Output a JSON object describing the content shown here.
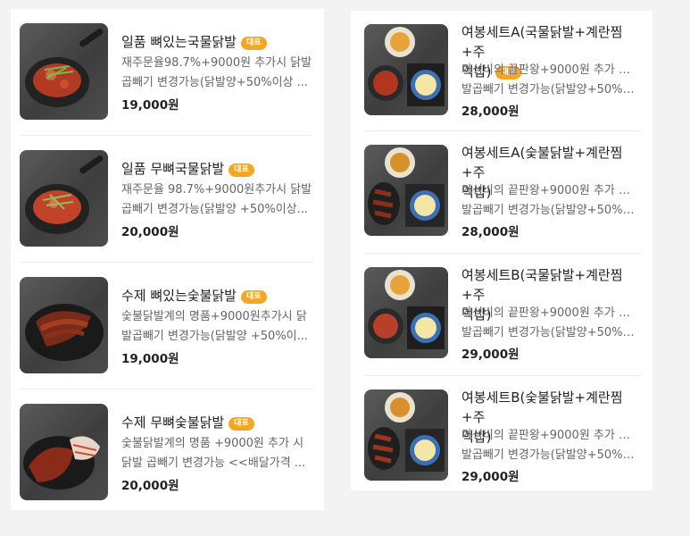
{
  "badge_label": "대표",
  "left_items": [
    {
      "title": "일품 뼈있는국물닭발",
      "desc_lines": [
        "재주문율98.7%+9000원 추가시 닭발",
        "곱빼기 변경가능(닭발양+50%이상 ..."
      ],
      "price": "19,000원"
    },
    {
      "title": "일품 무뼈국물닭발",
      "desc_lines": [
        "재주문율 98.7%+9000원추가시 닭발",
        "곱빼기 변경가능(닭발양 +50%이상..."
      ],
      "price": "20,000원"
    },
    {
      "title": "수제 뼈있는숯불닭발",
      "desc_lines": [
        "숯불닭발계의 명품+9000원추가시 닭",
        "발곱빼기 변경가능(닭발양 +50%이..."
      ],
      "price": "19,000원"
    },
    {
      "title": "수제 무뼈숯불닭발",
      "desc_lines": [
        "숯불닭발계의 명품 +9000원 추가 시",
        "닭발 곱빼기 변경가능 <<배달가격 ..."
      ],
      "price": "20,000원"
    }
  ],
  "right_items": [
    {
      "title_lines": [
        "여봉세트A(국물닭발+계란찜+주",
        "먹밥)"
      ],
      "desc_lines": [
        "가성비의 끝판왕+9000원 추가 시 닭",
        "발곱빼기 변경가능(닭발양+50%이..."
      ],
      "price": "28,000원",
      "has_badge": true
    },
    {
      "title_lines": [
        "여봉세트A(숯불닭발+계란찜+주",
        "먹밥)"
      ],
      "desc_lines": [
        "가성비의 끝판왕+9000원 추가 시 닭",
        "발곱빼기 변경가능(닭발양+50%이..."
      ],
      "price": "28,000원",
      "has_badge": false
    },
    {
      "title_lines": [
        "여봉세트B(국물닭발+계란찜+주",
        "먹밥)"
      ],
      "desc_lines": [
        "가성비의 끝판왕+9000원 추가 시 닭",
        "발곱빼기 변경가능(닭발양+50%이..."
      ],
      "price": "29,000원",
      "has_badge": false
    },
    {
      "title_lines": [
        "여봉세트B(숯불닭발+계란찜+주",
        "먹밥)"
      ],
      "desc_lines": [
        "가성비의 끝판왕+9000원 추가 시 닭",
        "발곱빼기 변경가능(닭발양+50%이..."
      ],
      "price": "29,000원",
      "has_badge": false
    }
  ]
}
